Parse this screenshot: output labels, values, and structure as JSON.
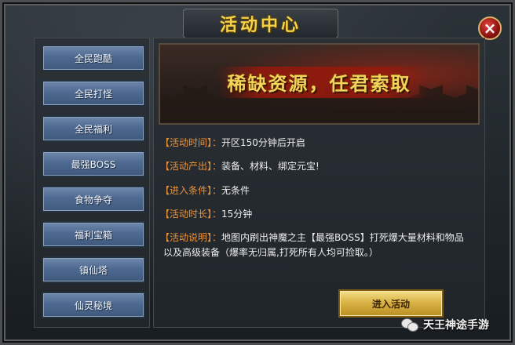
{
  "window": {
    "title": "活动中心",
    "close_symbol": "×"
  },
  "sidebar": {
    "items": [
      {
        "label": "全民跑酷"
      },
      {
        "label": "全民打怪"
      },
      {
        "label": "全民福利"
      },
      {
        "label": "最强BOSS"
      },
      {
        "label": "食物争夺"
      },
      {
        "label": "福利宝箱"
      },
      {
        "label": "镇仙塔"
      },
      {
        "label": "仙灵秘境"
      }
    ]
  },
  "banner": {
    "text": "稀缺资源，任君索取"
  },
  "details": {
    "time": {
      "label": "【活动时间】：",
      "value": "开区150分钟后开启"
    },
    "output": {
      "label": "【活动产出】：",
      "value": "装备、材料、绑定元宝!"
    },
    "cond": {
      "label": "【进入条件】：",
      "value": "无条件"
    },
    "dur": {
      "label": "【活动时长】：",
      "value": "15分钟"
    },
    "desc": {
      "label": "【活动说明】：",
      "value": "地图内刷出神魔之主【最强BOSS】打死爆大量材料和物品",
      "value2": "以及高级装备（爆率无归属,打死所有人均可捡取。）"
    }
  },
  "enter_button": {
    "label": "进入活动"
  },
  "watermark": {
    "text": "天王神途手游"
  },
  "colors": {
    "label": "#e9923a",
    "title": "#f4d34a",
    "sidebar_button": "#4e6a91",
    "enter_button": "#d9b347"
  }
}
